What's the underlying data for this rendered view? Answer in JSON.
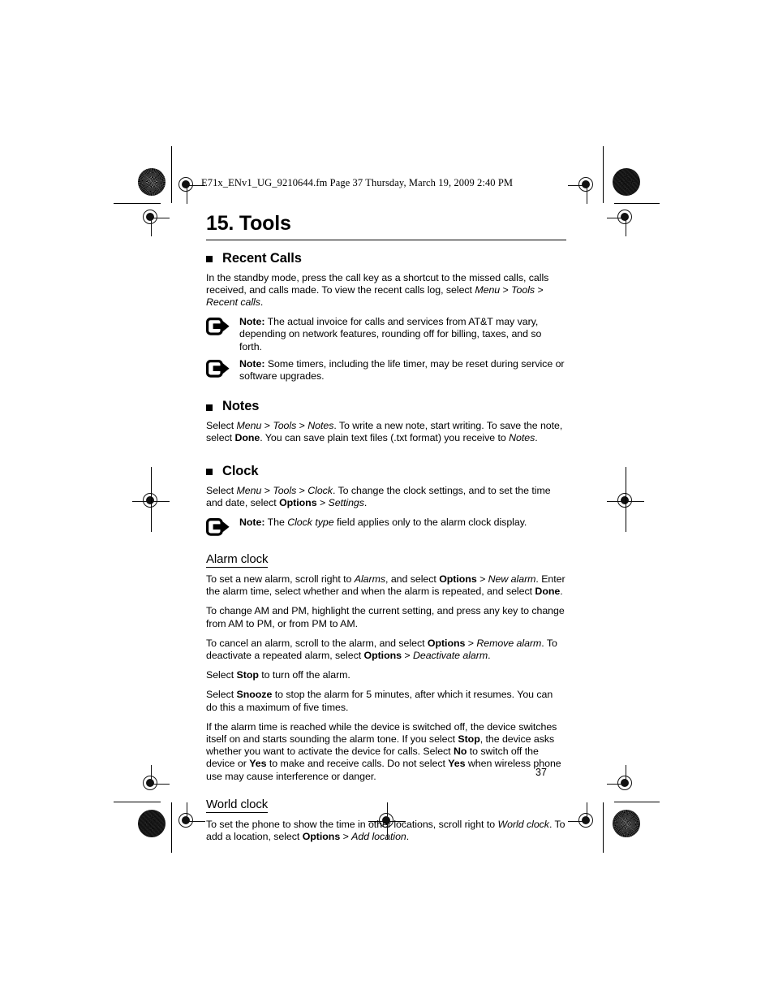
{
  "header": {
    "running_head": "E71x_ENv1_UG_9210644.fm  Page 37  Thursday, March 19, 2009  2:40 PM"
  },
  "chapter": {
    "title": "15. Tools"
  },
  "sections": {
    "recent_calls": {
      "heading": "Recent Calls",
      "para_1_a": "In the standby mode, press the call key as a shortcut to the missed calls, calls received, and calls made. To view the recent calls log, select ",
      "para_1_menu": "Menu",
      "para_1_gt1": " > ",
      "para_1_tools": "Tools",
      "para_1_gt2": " > ",
      "para_1_recentcalls": "Recent calls",
      "para_1_end": ".",
      "note_1_label": "Note:",
      "note_1_text": " The actual invoice for calls and services from AT&T may vary, depending on network features, rounding off for billing, taxes, and so forth.",
      "note_2_label": "Note:",
      "note_2_text": " Some timers, including the life timer, may be reset during service or software upgrades."
    },
    "notes": {
      "heading": "Notes",
      "p_select": "Select ",
      "p_menu": "Menu",
      "p_gt1": " > ",
      "p_tools": "Tools",
      "p_gt2": " > ",
      "p_notes": "Notes",
      "p_mid": ". To write a new note, start writing. To save the note, select ",
      "p_done": "Done",
      "p_tail": ". You can save plain text files (.txt format) you receive to ",
      "p_notes2": "Notes",
      "p_end": "."
    },
    "clock": {
      "heading": "Clock",
      "p_select": "Select ",
      "p_menu": "Menu",
      "p_gt1": " > ",
      "p_tools": "Tools",
      "p_gt2": " > ",
      "p_clock": "Clock",
      "p_mid": ". To change the clock settings, and to set the time and date, select ",
      "p_options": "Options",
      "p_gt3": " > ",
      "p_settings": "Settings",
      "p_end": ".",
      "note_label": "Note:",
      "note_a": " The ",
      "note_clocktype": "Clock type",
      "note_b": " field applies only to the alarm clock display."
    },
    "alarm_clock": {
      "heading": "Alarm clock",
      "p1_a": "To set a new alarm, scroll right to ",
      "p1_alarms": "Alarms",
      "p1_b": ", and select ",
      "p1_options": "Options",
      "p1_gt": " > ",
      "p1_newalarm": "New alarm",
      "p1_c": ". Enter the alarm time, select whether and when the alarm is repeated, and select ",
      "p1_done": "Done",
      "p1_end": ".",
      "p2": "To change AM and PM, highlight the current setting, and press any key to change from AM to PM, or from PM to AM.",
      "p3_a": "To cancel an alarm, scroll to the alarm, and select ",
      "p3_options": "Options",
      "p3_gt1": " > ",
      "p3_removealarm": "Remove alarm",
      "p3_b": ". To deactivate a repeated alarm, select ",
      "p3_options2": "Options",
      "p3_gt2": " > ",
      "p3_deactivate": "Deactivate alarm",
      "p3_end": ".",
      "p4_a": "Select ",
      "p4_stop": "Stop",
      "p4_b": " to turn off the alarm.",
      "p5_a": "Select ",
      "p5_snooze": "Snooze",
      "p5_b": " to stop the alarm for 5 minutes, after which it resumes. You can do this a maximum of five times.",
      "p6_a": "If the alarm time is reached while the device is switched off, the device switches itself on and starts sounding the alarm tone. If you select ",
      "p6_stop": "Stop",
      "p6_b": ", the device asks whether you want to activate the device for calls. Select ",
      "p6_no": "No",
      "p6_c": " to switch off the device or ",
      "p6_yes": "Yes",
      "p6_d": " to make and receive calls. Do not select ",
      "p6_yes2": "Yes",
      "p6_e": " when wireless phone use may cause interference or danger."
    },
    "world_clock": {
      "heading": "World clock",
      "p_a": "To set the phone to show the time in other locations, scroll right to ",
      "p_worldclock": "World clock",
      "p_b": ". To add a location, select ",
      "p_options": "Options",
      "p_gt": " > ",
      "p_addlocation": "Add location",
      "p_end": "."
    }
  },
  "footer": {
    "page_number": "37"
  },
  "icons": {
    "note_icon": "note-arrow-icon",
    "bullet": "square-bullet"
  },
  "colors": {
    "text": "#000000",
    "background": "#ffffff",
    "rule": "#000000"
  }
}
